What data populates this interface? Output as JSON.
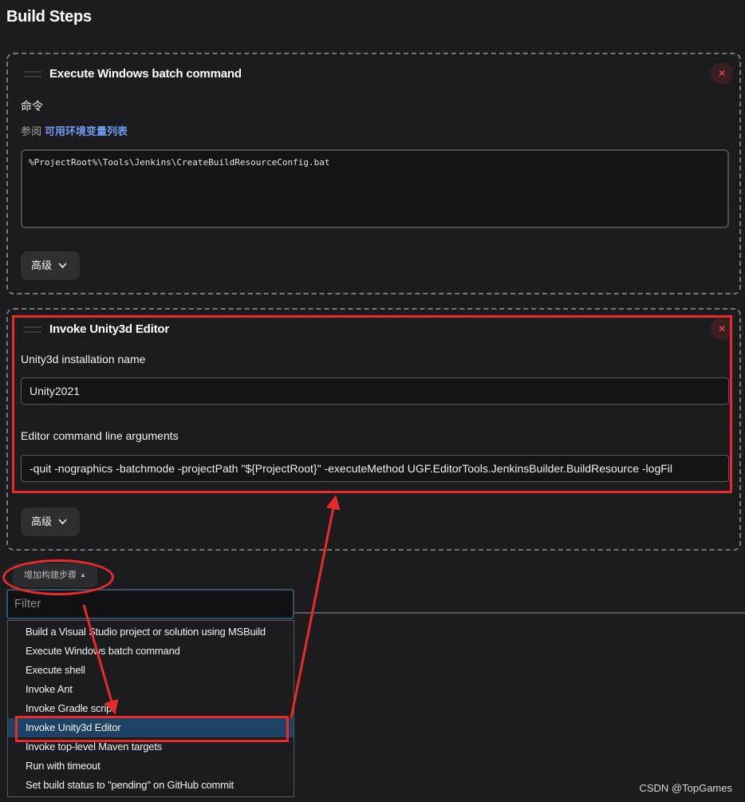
{
  "page": {
    "title": "Build Steps"
  },
  "steps": [
    {
      "title": "Execute Windows batch command",
      "command_label": "命令",
      "help_prefix": "参阅",
      "help_link": "可用环境变量列表",
      "command_value": "%ProjectRoot%\\Tools\\Jenkins\\CreateBuildResourceConfig.bat",
      "advanced_label": "高级",
      "delete_glyph": "✕"
    },
    {
      "title": "Invoke Unity3d Editor",
      "installation_label": "Unity3d installation name",
      "installation_value": "Unity2021",
      "args_label": "Editor command line arguments",
      "args_value": "-quit -nographics -batchmode -projectPath \"${ProjectRoot}\" -executeMethod UGF.EditorTools.JenkinsBuilder.BuildResource -logFil",
      "advanced_label": "高级",
      "delete_glyph": "✕"
    }
  ],
  "add_step": {
    "label": "增加构建步骤",
    "caret": "▲"
  },
  "filter": {
    "placeholder": "Filter"
  },
  "menu": {
    "items": [
      "Build a Visual Studio project or solution using MSBuild",
      "Execute Windows batch command",
      "Execute shell",
      "Invoke Ant",
      "Invoke Gradle script",
      "Invoke Unity3d Editor",
      "Invoke top-level Maven targets",
      "Run with timeout",
      "Set build status to \"pending\" on GitHub commit"
    ],
    "highlighted": "Invoke Unity3d Editor"
  },
  "watermark": "CSDN @TopGames",
  "colors": {
    "background": "#1c1c1e",
    "link": "#6f9cf0",
    "highlight": "#1d4264",
    "annotation": "#e82a2a",
    "delete": "#ff4c4c"
  },
  "icons": {
    "chevron": "chevron-down-icon",
    "delete": "close-icon",
    "drag": "drag-handle-icon"
  }
}
